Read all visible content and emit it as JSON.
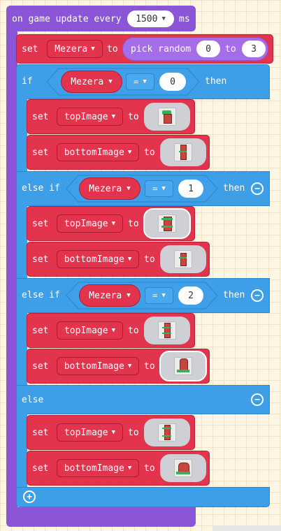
{
  "event": {
    "label": "on game update every",
    "interval": "1500",
    "unit": "ms"
  },
  "set1": {
    "set": "set",
    "var": "Mezera",
    "to": "to",
    "func": "pick random",
    "from": "0",
    "to2": "to",
    "max": "3"
  },
  "if1": {
    "keyword": "if",
    "var": "Mezera",
    "op": "=",
    "value": "0",
    "then": "then"
  },
  "b1_top": {
    "set": "set",
    "var": "topImage",
    "to": "to",
    "image": "sprite-tree-short"
  },
  "b1_bot": {
    "set": "set",
    "var": "bottomImage",
    "to": "to",
    "image": "sprite-pillar"
  },
  "elif1": {
    "keyword": "else if",
    "var": "Mezera",
    "op": "=",
    "value": "1",
    "then": "then"
  },
  "b2_top": {
    "set": "set",
    "var": "topImage",
    "to": "to",
    "image": "sprite-tree-mid"
  },
  "b2_bot": {
    "set": "set",
    "var": "bottomImage",
    "to": "to",
    "image": "sprite-pillar"
  },
  "elif2": {
    "keyword": "else if",
    "var": "Mezera",
    "op": "=",
    "value": "2",
    "then": "then"
  },
  "b3_top": {
    "set": "set",
    "var": "topImage",
    "to": "to",
    "image": "sprite-pillar-tall"
  },
  "b3_bot": {
    "set": "set",
    "var": "bottomImage",
    "to": "to",
    "image": "sprite-pillar-base"
  },
  "else": {
    "keyword": "else"
  },
  "b4_top": {
    "set": "set",
    "var": "topImage",
    "to": "to",
    "image": "sprite-pillar-long"
  },
  "b4_bot": {
    "set": "set",
    "var": "bottomImage",
    "to": "to",
    "image": "sprite-tree-base"
  },
  "icons": {
    "dropdown": "caret-down-icon",
    "remove": "minus-circle-icon",
    "add": "plus-circle-icon"
  },
  "colors": {
    "event": "#8b55d8",
    "variables": "#e3344e",
    "logic": "#3d9fe8"
  }
}
